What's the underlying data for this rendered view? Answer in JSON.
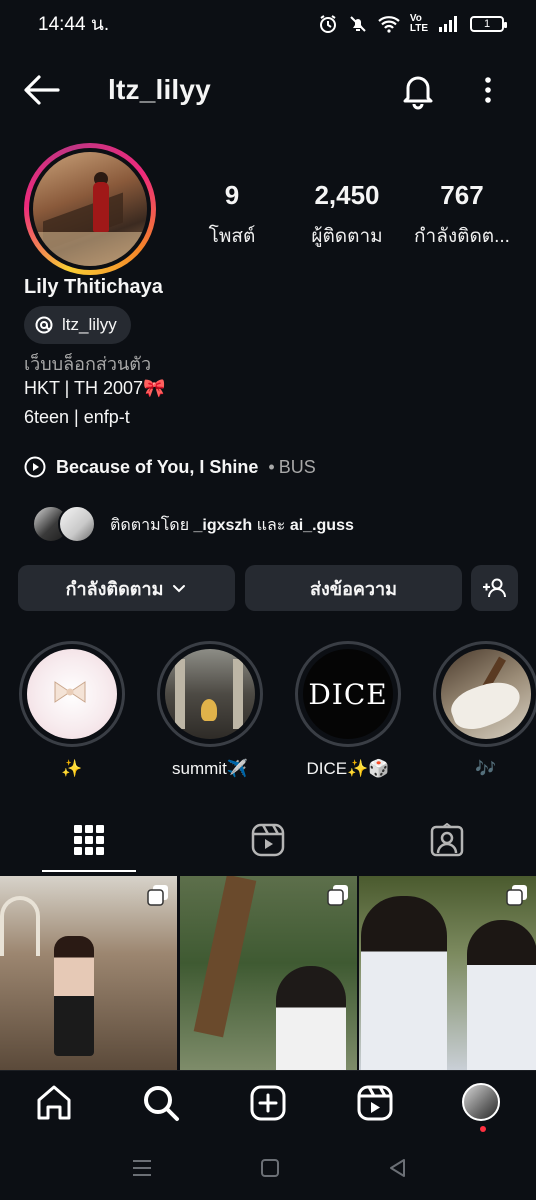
{
  "status_bar": {
    "time": "14:44 น.",
    "volte": "Vo\nLTE",
    "battery": "1"
  },
  "header": {
    "username": "ltz_lilyy"
  },
  "profile": {
    "full_name": "Lily Thitichaya",
    "threads_handle": "ltz_lilyy",
    "stats": [
      {
        "value": "9",
        "label": "โพสต์"
      },
      {
        "value": "2,450",
        "label": "ผู้ติดตาม"
      },
      {
        "value": "767",
        "label": "กำลังติดต..."
      }
    ],
    "bio": {
      "category": "เว็บบล็อกส่วนตัว",
      "line1": "HKT | TH 2007🎀",
      "line2": "6teen | enfp-t"
    },
    "music": {
      "title": "Because of You, I Shine",
      "separator": "•",
      "artist": "BUS"
    },
    "followed_by": {
      "prefix": "ติดตามโดย",
      "user1": "_igxszh",
      "conjunction": "และ",
      "user2": "ai_.guss"
    }
  },
  "actions": {
    "following_label": "กำลังติดตาม",
    "message_label": "ส่งข้อความ"
  },
  "highlights": [
    {
      "label": "✨"
    },
    {
      "label": "summit✈️"
    },
    {
      "label": "DICE✨🎲",
      "cover_text": "DICE"
    },
    {
      "label": "🎶"
    }
  ],
  "colors": {
    "background": "#0c0f14",
    "button": "#262a31",
    "notification_dot": "#ff3040"
  }
}
